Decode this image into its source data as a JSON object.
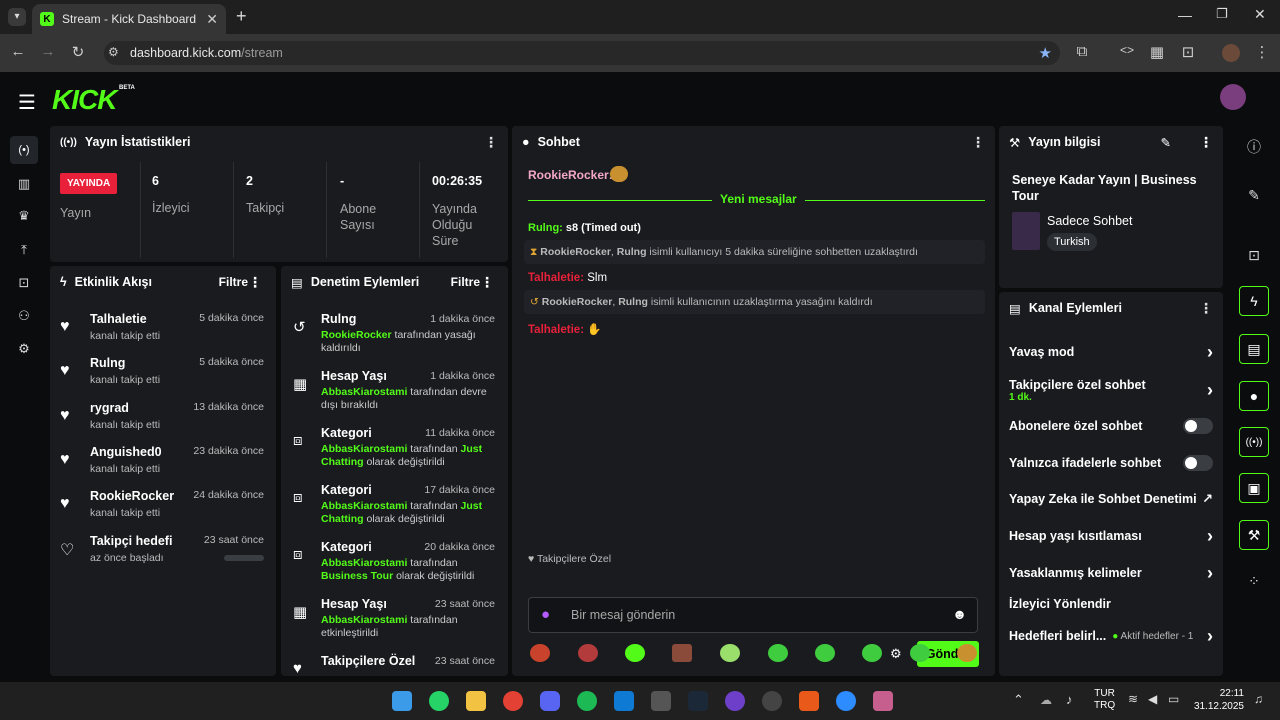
{
  "browser": {
    "tab_title": "Stream - Kick Dashboard",
    "url_host": "dashboard.kick.com",
    "url_path": "/stream"
  },
  "brand": {
    "logo": "KICK",
    "beta": "BETA",
    "accent": "#53fc18"
  },
  "stats": {
    "title": "Yayın İstatistikleri",
    "live_badge": "YAYINDA",
    "live_label": "Yayın",
    "items": [
      {
        "value": "6",
        "label": "İzleyici"
      },
      {
        "value": "2",
        "label": "Takipçi"
      },
      {
        "value": "-",
        "label": "Abone Sayısı"
      },
      {
        "value": "00:26:35",
        "label": "Yayında Olduğu Süre"
      }
    ]
  },
  "activity": {
    "title": "Etkinlik Akışı",
    "filter": "Filtre",
    "items": [
      {
        "name": "Talhaletie",
        "sub": "kanalı takip etti",
        "time": "5 dakika önce"
      },
      {
        "name": "Rulng",
        "sub": "kanalı takip etti",
        "time": "5 dakika önce"
      },
      {
        "name": "rygrad",
        "sub": "kanalı takip etti",
        "time": "13 dakika önce"
      },
      {
        "name": "Anguished0",
        "sub": "kanalı takip etti",
        "time": "23 dakika önce"
      },
      {
        "name": "RookieRocker",
        "sub": "kanalı takip etti",
        "time": "24 dakika önce"
      },
      {
        "name": "Takipçi hedefi",
        "sub": "az önce başladı",
        "time": "23 saat önce"
      }
    ]
  },
  "moderation": {
    "title": "Denetim Eylemleri",
    "filter": "Filtre",
    "items": [
      {
        "name": "Rulng",
        "time": "1 dakika önce",
        "user": "RookieRocker",
        "text": " tarafından yasağı kaldırıldı",
        "extra": "",
        "tail": ""
      },
      {
        "name": "Hesap Yaşı",
        "time": "1 dakika önce",
        "user": "AbbasKiarostami",
        "text": " tarafından devre dışı bırakıldı",
        "extra": "",
        "tail": ""
      },
      {
        "name": "Kategori",
        "time": "11 dakika önce",
        "user": "AbbasKiarostami",
        "text": " tarafından ",
        "extra": "Just Chatting",
        "tail": " olarak değiştirildi"
      },
      {
        "name": "Kategori",
        "time": "17 dakika önce",
        "user": "AbbasKiarostami",
        "text": " tarafından ",
        "extra": "Just Chatting",
        "tail": " olarak değiştirildi"
      },
      {
        "name": "Kategori",
        "time": "20 dakika önce",
        "user": "AbbasKiarostami",
        "text": " tarafından ",
        "extra": "Business Tour",
        "tail": " olarak değiştirildi"
      },
      {
        "name": "Hesap Yaşı",
        "time": "23 saat önce",
        "user": "AbbasKiarostami",
        "text": " tarafından etkinleştirildi",
        "extra": "",
        "tail": ""
      },
      {
        "name": "Takipçilere Özel",
        "time": "23 saat önce",
        "user": "",
        "text": "",
        "extra": "",
        "tail": ""
      }
    ]
  },
  "chat": {
    "title": "Sohbet",
    "new_messages": "Yeni mesajlar",
    "m1_user": "RookieRocker:",
    "m2_user": "Rulng:",
    "m2_text": "s8 (Timed out)",
    "sys1_user1": "RookieRocker",
    "sys1_user2": "Rulng",
    "sys1_text": " isimli kullanıcıyı 5 dakika süreliğine sohbetten uzaklaştırdı",
    "m3_user": "Talhaletie:",
    "m3_text": "Slm",
    "sys2_user1": "RookieRocker",
    "sys2_user2": "Rulng",
    "sys2_text": " isimli kullanıcının uzaklaştırma yasağını kaldırdı",
    "m4_user": "Talhaletie:",
    "followers_only": "Takipçilere Özel",
    "placeholder": "Bir mesaj gönderin",
    "send": "Gönder"
  },
  "info": {
    "title": "Yayın bilgisi",
    "stream_title": "Seneye Kadar Yayın | Business Tour",
    "category": "Sadece Sohbet",
    "language": "Turkish"
  },
  "channel": {
    "title": "Kanal Eylemleri",
    "items": [
      {
        "label": "Yavaş mod",
        "sub": ""
      },
      {
        "label": "Takipçilere özel sohbet",
        "sub": "1 dk."
      },
      {
        "label": "Abonelere özel sohbet",
        "sub": ""
      },
      {
        "label": "Yalnızca ifadelerle sohbet",
        "sub": ""
      },
      {
        "label": "Yapay Zeka ile Sohbet Denetimi",
        "sub": ""
      },
      {
        "label": "Hesap yaşı kısıtlaması",
        "sub": ""
      },
      {
        "label": "Yasaklanmış kelimeler",
        "sub": ""
      },
      {
        "label": "İzleyici Yönlendir",
        "sub": ""
      },
      {
        "label": "Hedefleri belirl...",
        "sub": "Aktif hedefler - 1"
      }
    ]
  },
  "taskbar": {
    "lang1": "TUR",
    "lang2": "TRQ",
    "time": "22:11",
    "date": "31.12.2025"
  }
}
